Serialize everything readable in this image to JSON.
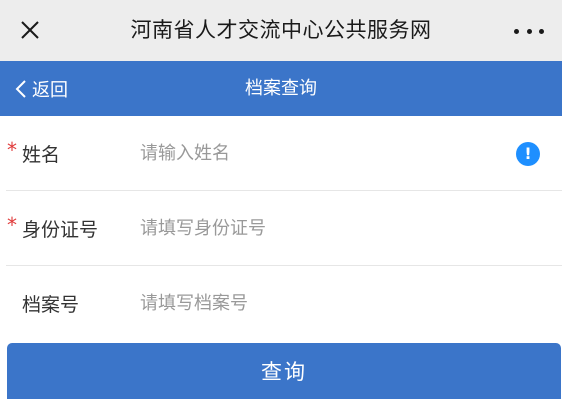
{
  "window": {
    "title": "河南省人才交流中心公共服务网",
    "close_icon": "close-icon",
    "more_icon": "more-icon"
  },
  "nav": {
    "back_label": "返回",
    "title": "档案查询"
  },
  "form": {
    "fields": [
      {
        "label": "姓名",
        "placeholder": "请输入姓名",
        "required": true,
        "has_alert": true
      },
      {
        "label": "身份证号",
        "placeholder": "请填写身份证号",
        "required": true,
        "has_alert": false
      },
      {
        "label": "档案号",
        "placeholder": "请填写档案号",
        "required": false,
        "has_alert": false
      }
    ],
    "alert_glyph": "!",
    "required_mark": "*"
  },
  "submit_label": "查询",
  "colors": {
    "accent": "#3b75c9",
    "required": "#e03b3b",
    "alert": "#1e8fff"
  }
}
